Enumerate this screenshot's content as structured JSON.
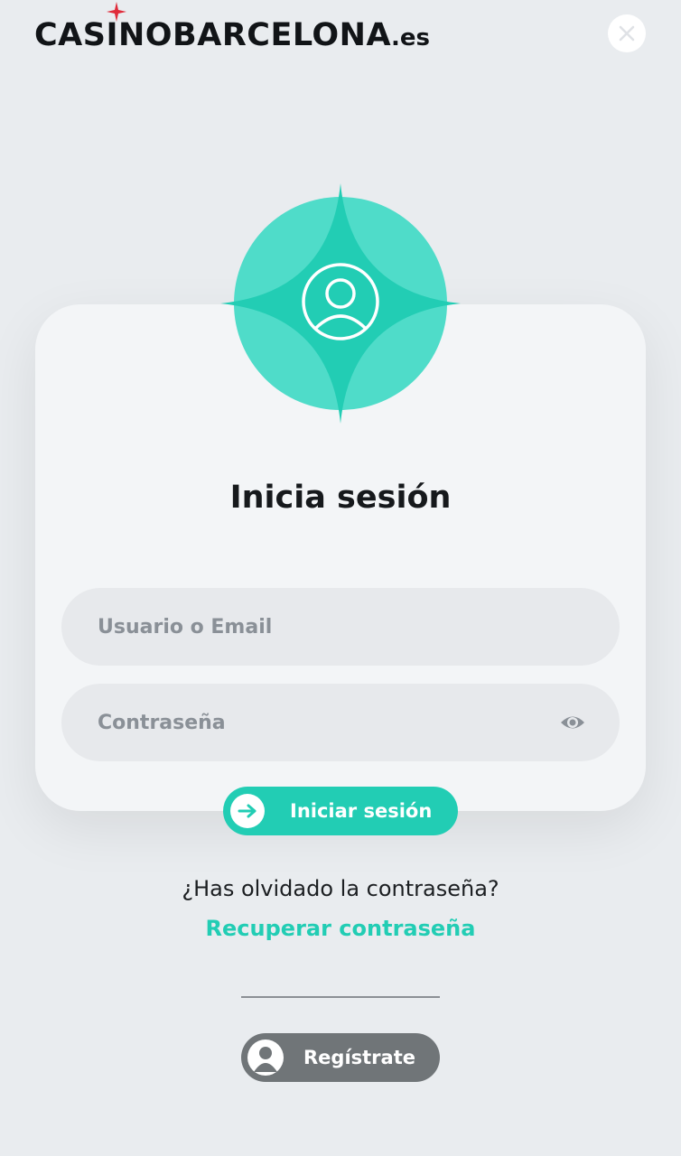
{
  "header": {
    "logo_main": "CASINOBARCELONA",
    "logo_tld": ".es",
    "logo_star_icon": "star-sparkle-icon",
    "close_icon": "close-icon"
  },
  "login": {
    "badge_icon": "user-avatar-icon",
    "title": "Inicia sesión",
    "username_placeholder": "Usuario o Email",
    "password_placeholder": "Contraseña",
    "eye_icon": "eye-icon",
    "submit_label": "Iniciar sesión",
    "submit_icon": "arrow-right-icon",
    "forgot_text": "¿Has olvidado la contraseña?",
    "recover_link": "Recuperar contraseña",
    "register_label": "Regístrate",
    "register_icon": "user-icon"
  },
  "colors": {
    "accent": "#22cdb4",
    "background": "#e9ecef",
    "card": "#f3f5f7",
    "register_button": "#707578",
    "logo_star": "#e02b3a"
  }
}
